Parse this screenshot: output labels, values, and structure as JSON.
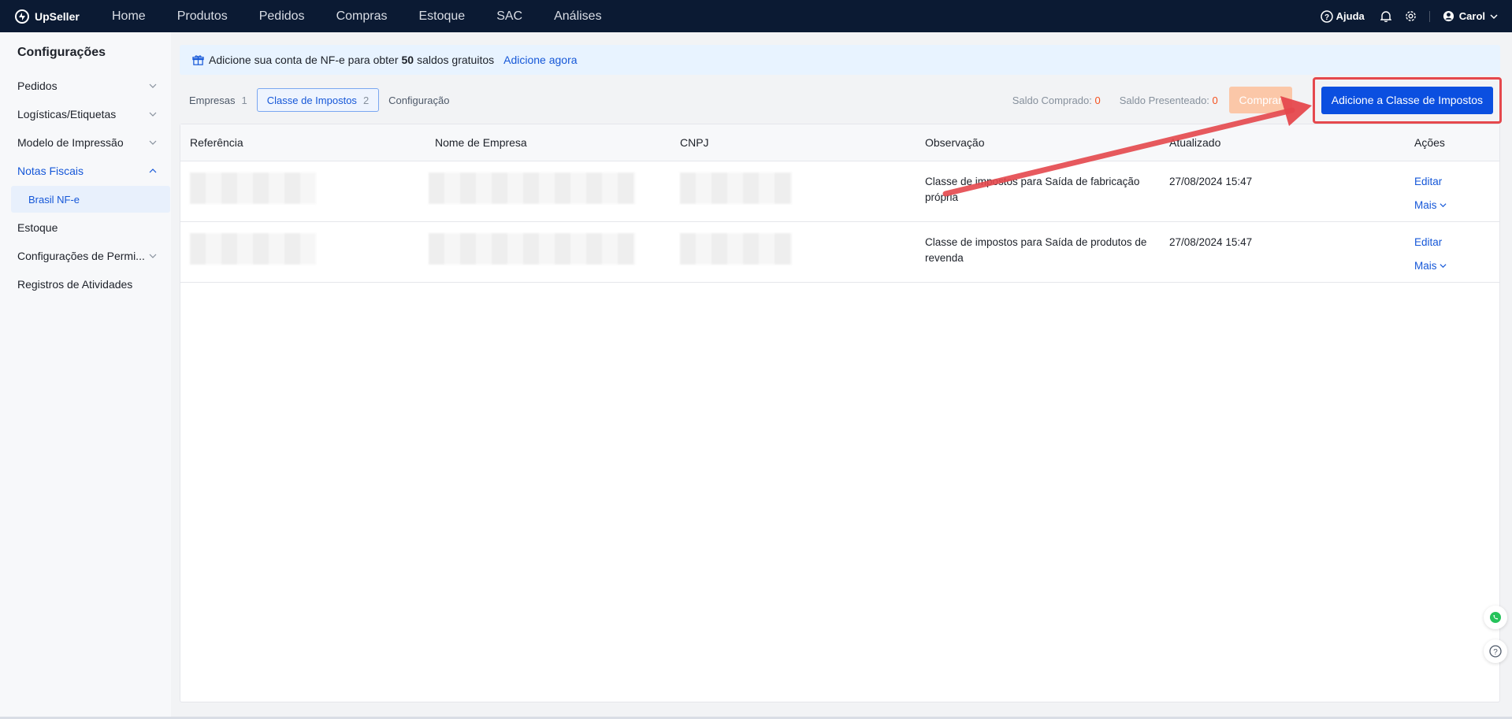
{
  "brand": {
    "name": "UpSeller"
  },
  "nav": {
    "items": [
      "Home",
      "Produtos",
      "Pedidos",
      "Compras",
      "Estoque",
      "SAC",
      "Análises"
    ]
  },
  "top_right": {
    "help": "Ajuda",
    "user": "Carol"
  },
  "sidebar": {
    "title": "Configurações",
    "items": [
      {
        "label": "Pedidos"
      },
      {
        "label": "Logísticas/Etiquetas"
      },
      {
        "label": "Modelo de Impressão"
      },
      {
        "label": "Notas Fiscais"
      },
      {
        "label": "Brasil NF-e"
      },
      {
        "label": "Estoque"
      },
      {
        "label": "Configurações de Permi..."
      },
      {
        "label": "Registros de Atividades"
      }
    ]
  },
  "banner": {
    "text_before": "Adicione sua conta de NF-e para obter",
    "bold": "50",
    "text_after": "saldos gratuitos",
    "link": "Adicione agora"
  },
  "tabs": [
    {
      "label": "Empresas",
      "count": "1"
    },
    {
      "label": "Classe de Impostos",
      "count": "2"
    },
    {
      "label": "Configuração"
    }
  ],
  "balance": {
    "comprado_label": "Saldo Comprado:",
    "comprado_value": "0",
    "presenteado_label": "Saldo Presenteado:",
    "presenteado_value": "0"
  },
  "buttons": {
    "comprar": "Comprar",
    "add": "Adicione a Classe de Impostos"
  },
  "table": {
    "columns": [
      "Referência",
      "Nome de Empresa",
      "CNPJ",
      "Observação",
      "Atualizado",
      "Ações"
    ],
    "rows": [
      {
        "observacao": "Classe de impostos para Saída de fabricação própria",
        "atualizado": "27/08/2024 15:47",
        "edit": "Editar",
        "more": "Mais"
      },
      {
        "observacao": "Classe de impostos para Saída de produtos de revenda",
        "atualizado": "27/08/2024 15:47",
        "edit": "Editar",
        "more": "Mais"
      }
    ]
  },
  "colors": {
    "topbar": "#0b1a33",
    "primary": "#0b4fe0",
    "link": "#1557d8",
    "highlight": "#e5484d",
    "accent": "#f5511e"
  },
  "icons": [
    "logo-icon",
    "help-icon",
    "bell-icon",
    "gear-icon",
    "user-icon",
    "chevron-down-icon",
    "chevron-up-icon",
    "gift-icon",
    "whatsapp-icon",
    "question-icon"
  ]
}
